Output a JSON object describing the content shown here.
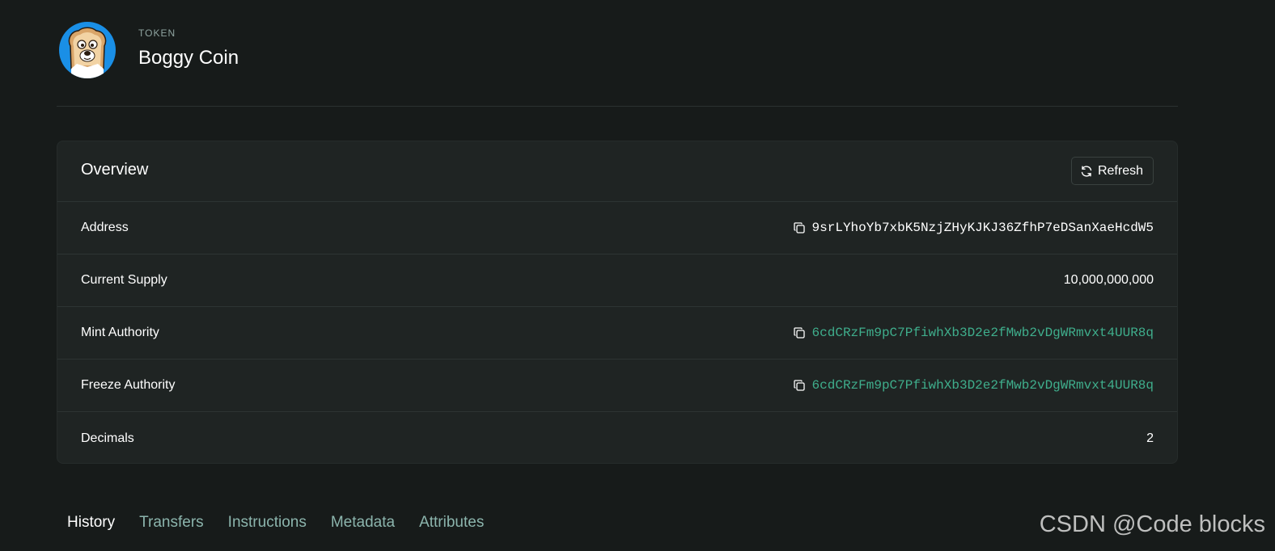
{
  "header": {
    "eyebrow": "TOKEN",
    "token_name": "Boggy Coin",
    "avatar_icon": "dog-toast-avatar-icon"
  },
  "overview": {
    "title": "Overview",
    "refresh_label": "Refresh",
    "rows": [
      {
        "label": "Address",
        "value": "9srLYhoYb7xbK5NzjZHyKJKJ36ZfhP7eDSanXaeHcdW5",
        "copyable": true,
        "link": false
      },
      {
        "label": "Current Supply",
        "value": "10,000,000,000",
        "copyable": false,
        "link": false
      },
      {
        "label": "Mint Authority",
        "value": "6cdCRzFm9pC7PfiwhXb3D2e2fMwb2vDgWRmvxt4UUR8q",
        "copyable": true,
        "link": true
      },
      {
        "label": "Freeze Authority",
        "value": "6cdCRzFm9pC7PfiwhXb3D2e2fMwb2vDgWRmvxt4UUR8q",
        "copyable": true,
        "link": true
      },
      {
        "label": "Decimals",
        "value": "2",
        "copyable": false,
        "link": false
      }
    ]
  },
  "tabs": [
    {
      "label": "History",
      "active": true
    },
    {
      "label": "Transfers",
      "active": false
    },
    {
      "label": "Instructions",
      "active": false
    },
    {
      "label": "Metadata",
      "active": false
    },
    {
      "label": "Attributes",
      "active": false
    }
  ],
  "watermark": "CSDN @Code blocks",
  "colors": {
    "background": "#171b1a",
    "card": "#1f2423",
    "link": "#3fae8c",
    "tab_inactive": "#8cb5ad",
    "avatar_bg": "#1a8fe6"
  }
}
